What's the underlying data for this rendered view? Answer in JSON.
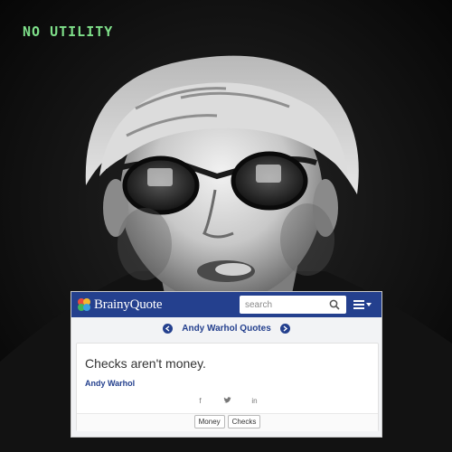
{
  "overlay": {
    "title": "NO UTILITY"
  },
  "browser": {
    "brand": "BrainyQuote",
    "search": {
      "placeholder": "search",
      "value": ""
    },
    "menu_icon": "hamburger-icon",
    "accent_color": "#24408e"
  },
  "subnav": {
    "title": "Andy Warhol Quotes",
    "prev_icon": "chevron-left-icon",
    "next_icon": "chevron-right-icon"
  },
  "quote": {
    "text": "Checks aren't money.",
    "author": "Andy Warhol",
    "share_icons": [
      "facebook-icon",
      "twitter-icon",
      "linkedin-icon"
    ],
    "share_glyphs": [
      "f",
      "✉",
      "in"
    ],
    "tags": [
      "Money",
      "Checks"
    ]
  }
}
